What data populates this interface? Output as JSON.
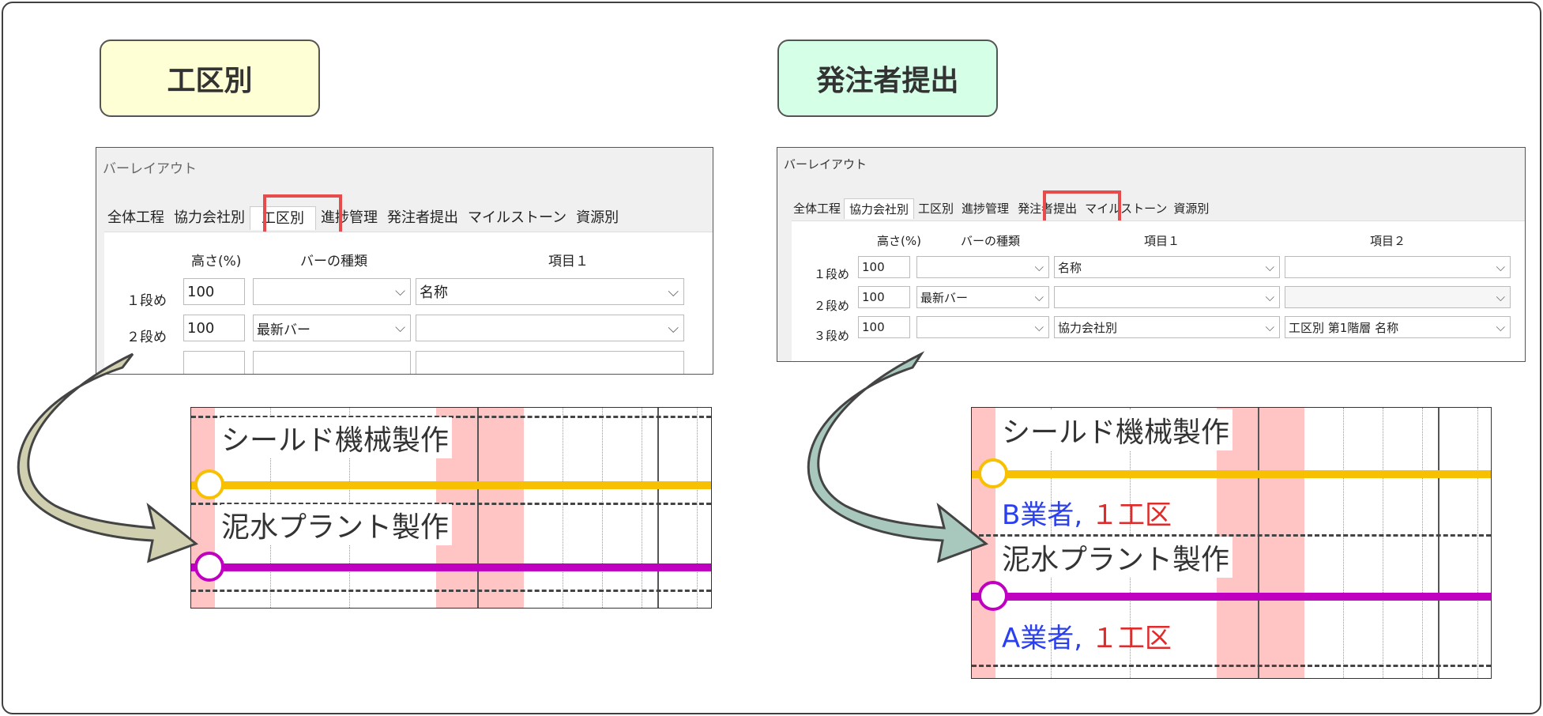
{
  "left": {
    "badge": "工区別",
    "dialog": {
      "title": "バーレイアウト",
      "tabs": [
        "全体工程",
        "協力会社別",
        "工区別",
        "進捗管理",
        "発注者提出",
        "マイルストーン",
        "資源別"
      ],
      "selected_tab": "工区別",
      "headers": {
        "height": "高さ(%)",
        "bar_type": "バーの種類",
        "item1": "項目１"
      },
      "rows": [
        {
          "label": "１段め",
          "height": "100",
          "bar_type": "",
          "item1": "名称"
        },
        {
          "label": "２段め",
          "height": "100",
          "bar_type": "最新バー",
          "item1": ""
        }
      ]
    },
    "gantt": {
      "rows": [
        {
          "name": "シールド機械製作",
          "bar_color": "#f7c000"
        },
        {
          "name": "泥水プラント製作",
          "bar_color": "#c000c0"
        }
      ]
    }
  },
  "right": {
    "badge": "発注者提出",
    "dialog": {
      "title": "バーレイアウト",
      "tabs": [
        "全体工程",
        "協力会社別",
        "工区別",
        "進捗管理",
        "発注者提出",
        "マイルストーン",
        "資源別"
      ],
      "selected_tab": "協力会社別",
      "highlighted_tab": "発注者提出",
      "headers": {
        "height": "高さ(%)",
        "bar_type": "バーの種類",
        "item1": "項目１",
        "item2": "項目２"
      },
      "rows": [
        {
          "label": "１段め",
          "height": "100",
          "bar_type": "",
          "item1": "名称",
          "item2": ""
        },
        {
          "label": "２段め",
          "height": "100",
          "bar_type": "最新バー",
          "item1": "",
          "item2": ""
        },
        {
          "label": "３段め",
          "height": "100",
          "bar_type": "",
          "item1": "協力会社別",
          "item2": "工区別 第1階層 名称"
        }
      ]
    },
    "gantt": {
      "rows": [
        {
          "name": "シールド機械製作",
          "bar_color": "#f7c000",
          "company": "B業者,",
          "section": "１工区"
        },
        {
          "name": "泥水プラント製作",
          "bar_color": "#c000c0",
          "company": "A業者,",
          "section": "１工区"
        }
      ]
    }
  },
  "colors": {
    "highlight": "#e84b4b",
    "arrow_left": "#ffffd6",
    "arrow_right": "#d6ffe8"
  }
}
